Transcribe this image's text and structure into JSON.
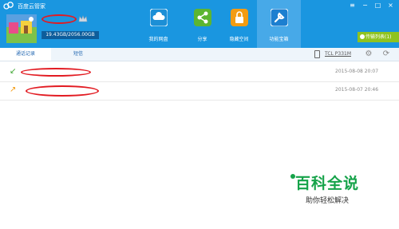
{
  "window": {
    "title": "百度云管家",
    "controls": [
      "≡",
      "−",
      "□",
      "×"
    ]
  },
  "account": {
    "storage_text": "19.43GB/2056.00GB",
    "storage_used_fraction": 0.0095
  },
  "nav": [
    {
      "label": "我的网盘",
      "icon": "cloud-icon",
      "color": "#1c8fd6"
    },
    {
      "label": "分享",
      "icon": "share-icon",
      "color": "#5cb531"
    },
    {
      "label": "隐藏空间",
      "icon": "lock-icon",
      "color": "#f39c12"
    },
    {
      "label": "功能宝箱",
      "icon": "wrench-icon",
      "color": "#1c7fd0"
    }
  ],
  "transfer_button": {
    "label": "传输列表(1)"
  },
  "tabs": [
    {
      "label": "通话记录"
    },
    {
      "label": "短信"
    }
  ],
  "device": {
    "name": "TCL P331M"
  },
  "records": [
    {
      "direction": "incoming",
      "arrow": "↙",
      "arrow_color": "#3aa52e",
      "time": "2015-08-08 20:07"
    },
    {
      "direction": "outgoing",
      "arrow": "↗",
      "arrow_color": "#f39c12",
      "time": "2015-08-07 20:46"
    }
  ],
  "watermark": {
    "main": "百科全说",
    "sub": "助你轻松解决"
  }
}
